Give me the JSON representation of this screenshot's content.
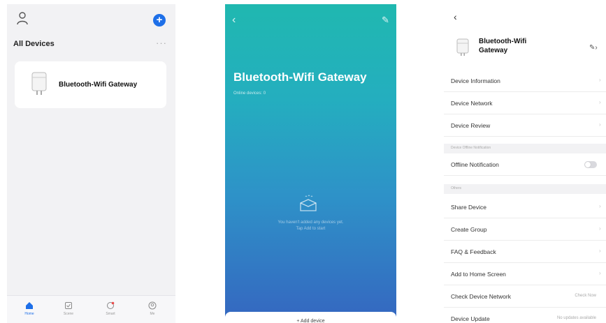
{
  "home": {
    "section_title": "All Devices",
    "more": "···",
    "device_name": "Bluetooth-Wifi Gateway",
    "tabs": [
      {
        "label": "Home",
        "icon": "home-icon"
      },
      {
        "label": "Scene",
        "icon": "scene-icon"
      },
      {
        "label": "Smart",
        "icon": "smart-icon"
      },
      {
        "label": "Me",
        "icon": "profile-icon"
      }
    ]
  },
  "gateway": {
    "title": "Bluetooth-Wifi Gateway",
    "online_devices": "Online devices: 0",
    "empty_line1": "You haven't added any devices yet.",
    "empty_line2": "Tap Add to start",
    "add_device": "+ Add device"
  },
  "settings": {
    "device_name_line1": "Bluetooth-Wifi",
    "device_name_line2": "Gateway",
    "rows_a": [
      {
        "label": "Device Information"
      },
      {
        "label": "Device Network"
      },
      {
        "label": "Device Review"
      }
    ],
    "section_offline": "Device Offline Notification",
    "offline_label": "Offline Notification",
    "offline_enabled": false,
    "section_others": "Others",
    "rows_b": [
      {
        "label": "Share Device"
      },
      {
        "label": "Create Group"
      },
      {
        "label": "FAQ & Feedback"
      },
      {
        "label": "Add to Home Screen"
      }
    ],
    "check_network_label": "Check Device Network",
    "check_network_value": "Check Now",
    "update_label": "Device Update",
    "update_value": "No updates available"
  },
  "colors": {
    "accent": "#1e6fe8",
    "gradient_top": "#20b8b0",
    "gradient_bottom": "#3566c0"
  }
}
